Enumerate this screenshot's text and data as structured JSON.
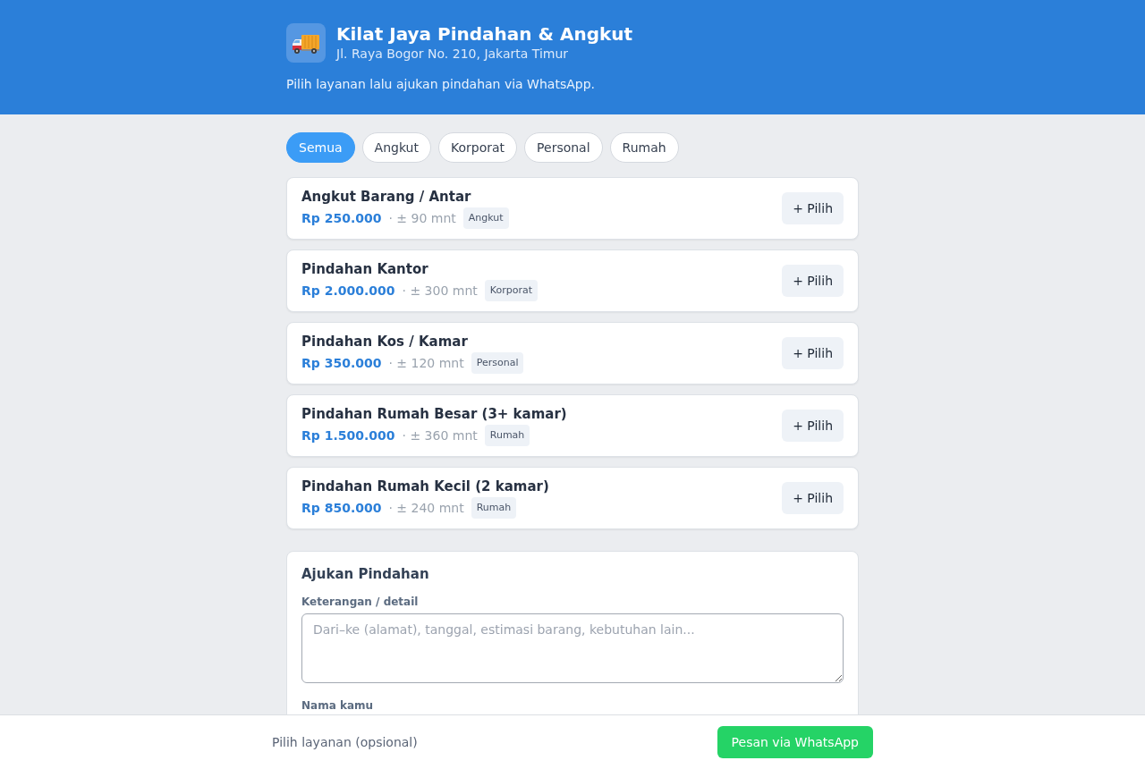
{
  "header": {
    "title": "Kilat Jaya Pindahan & Angkut",
    "address": "Jl. Raya Bogor No. 210, Jakarta Timur",
    "tagline": "Pilih layanan lalu ajukan pindahan via WhatsApp."
  },
  "tabs": [
    {
      "label": "Semua",
      "selected": true
    },
    {
      "label": "Angkut",
      "selected": false
    },
    {
      "label": "Korporat",
      "selected": false
    },
    {
      "label": "Personal",
      "selected": false
    },
    {
      "label": "Rumah",
      "selected": false
    }
  ],
  "services": [
    {
      "name": "Angkut Barang / Antar",
      "price": "Rp 250.000",
      "duration": "· ± 90 mnt",
      "category": "Angkut",
      "button": "+ Pilih"
    },
    {
      "name": "Pindahan Kantor",
      "price": "Rp 2.000.000",
      "duration": "· ± 300 mnt",
      "category": "Korporat",
      "button": "+ Pilih"
    },
    {
      "name": "Pindahan Kos / Kamar",
      "price": "Rp 350.000",
      "duration": "· ± 120 mnt",
      "category": "Personal",
      "button": "+ Pilih"
    },
    {
      "name": "Pindahan Rumah Besar (3+ kamar)",
      "price": "Rp 1.500.000",
      "duration": "· ± 360 mnt",
      "category": "Rumah",
      "button": "+ Pilih"
    },
    {
      "name": "Pindahan Rumah Kecil (2 kamar)",
      "price": "Rp 850.000",
      "duration": "· ± 240 mnt",
      "category": "Rumah",
      "button": "+ Pilih"
    }
  ],
  "request_form": {
    "title": "Ajukan Pindahan",
    "details": {
      "label": "Keterangan / detail",
      "placeholder": "Dari–ke (alamat), tanggal, estimasi barang, kebutuhan lain..."
    },
    "name_label": "Nama kamu"
  },
  "bottom_bar": {
    "hint": "Pilih layanan (opsional)",
    "button": "Pesan via WhatsApp"
  }
}
